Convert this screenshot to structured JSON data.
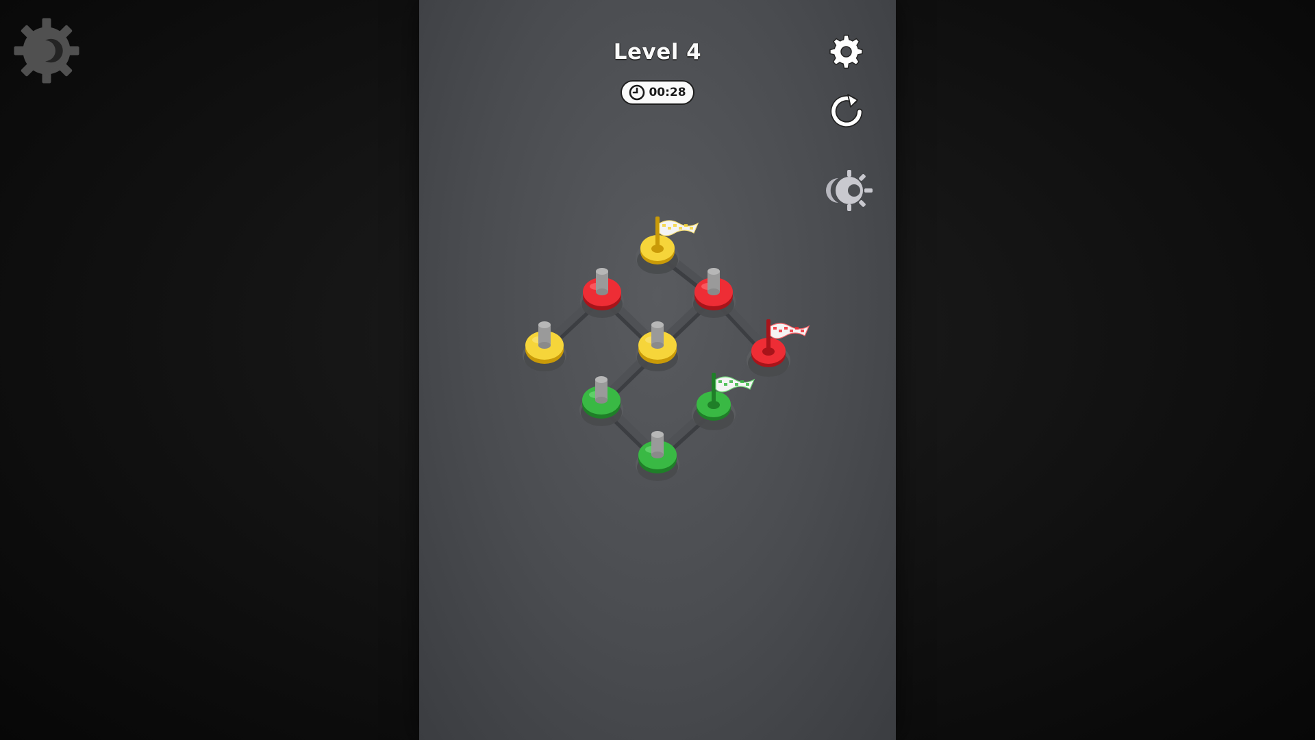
{
  "level": {
    "title": "Level 4"
  },
  "timer": {
    "value": "00:28",
    "icon": "clock-icon"
  },
  "toolbar": {
    "settings_icon": "gear-icon",
    "restart_icon": "restart-icon",
    "theme_icon": "theme-toggle-icon"
  },
  "colors": {
    "yellow": "#f2c81e",
    "red": "#e8232b",
    "green": "#2fae3a",
    "peg": "#9a9a9a",
    "path": "#4f5155"
  },
  "board": {
    "nodes": [
      {
        "id": "top",
        "color": "yellow",
        "type": "flag"
      },
      {
        "id": "upper-left",
        "color": "red",
        "type": "ring"
      },
      {
        "id": "upper-right",
        "color": "red",
        "type": "ring"
      },
      {
        "id": "left",
        "color": "yellow",
        "type": "ring"
      },
      {
        "id": "center",
        "color": "yellow",
        "type": "ring"
      },
      {
        "id": "right",
        "color": "red",
        "type": "flag"
      },
      {
        "id": "lower-left",
        "color": "green",
        "type": "ring"
      },
      {
        "id": "lower-right",
        "color": "green",
        "type": "flag"
      },
      {
        "id": "bottom",
        "color": "green",
        "type": "ring"
      }
    ],
    "edges": [
      [
        "top",
        "upper-right"
      ],
      [
        "upper-left",
        "left"
      ],
      [
        "upper-left",
        "center"
      ],
      [
        "upper-right",
        "center"
      ],
      [
        "upper-right",
        "right"
      ],
      [
        "center",
        "lower-left"
      ],
      [
        "lower-left",
        "bottom"
      ],
      [
        "bottom",
        "lower-right"
      ]
    ]
  }
}
